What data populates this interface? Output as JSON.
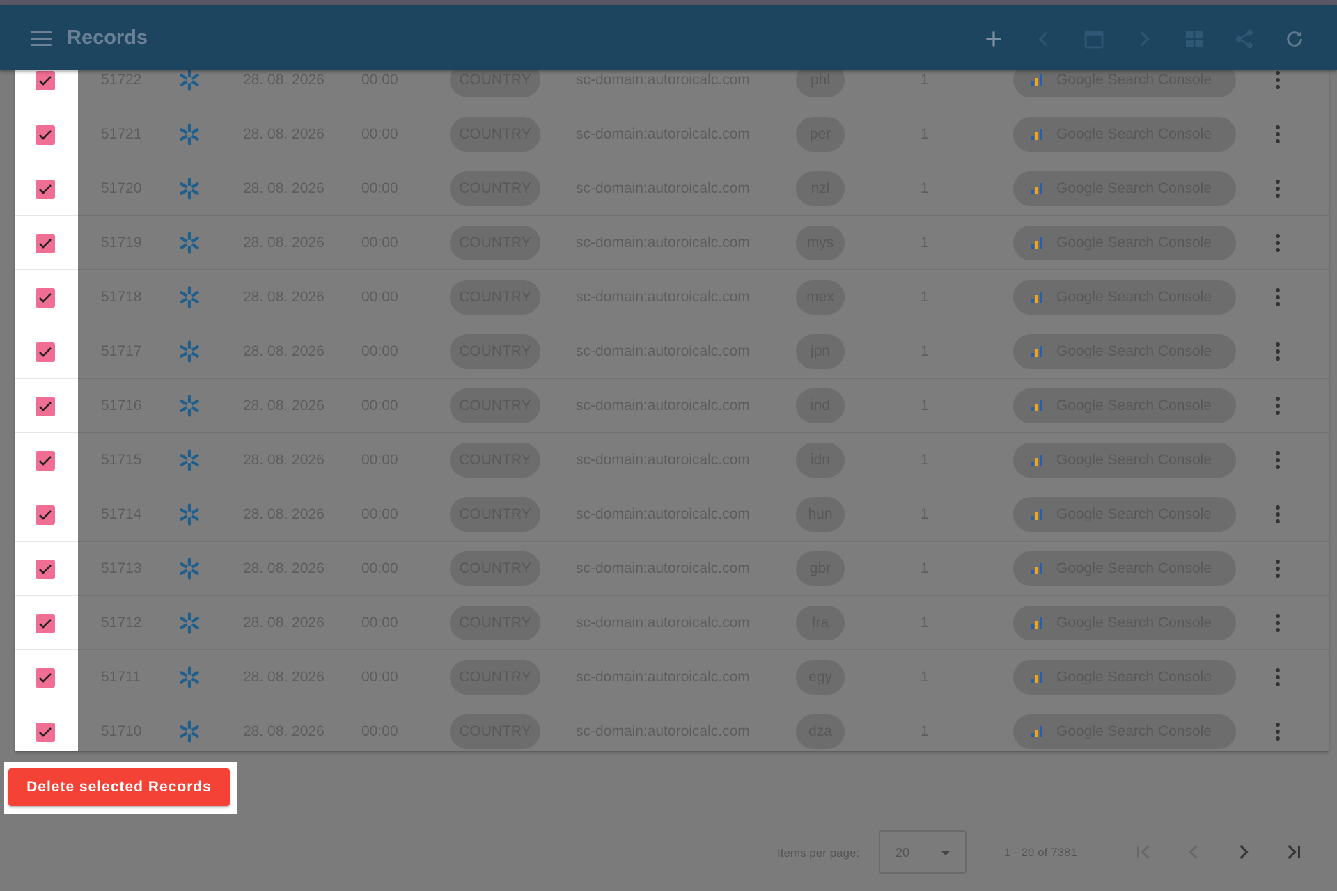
{
  "app": {
    "title": "Records"
  },
  "toolbar": {
    "icons": [
      "menu-icon",
      "add-icon",
      "chevron-left-icon",
      "calendar-icon",
      "chevron-right-icon",
      "grid-icon",
      "share-icon",
      "refresh-icon"
    ]
  },
  "colors": {
    "toolbar": "#1e4560",
    "checkbox": "#f06d93",
    "delete_button": "#f44336",
    "spark": "#1f5f8e"
  },
  "rows": [
    {
      "id": "51722",
      "date": "28. 08. 2026",
      "time": "00:00",
      "type": "COUNTRY",
      "domain": "sc-domain:autoroicalc.com",
      "code": "phl",
      "count": "1",
      "source": "Google Search Console"
    },
    {
      "id": "51721",
      "date": "28. 08. 2026",
      "time": "00:00",
      "type": "COUNTRY",
      "domain": "sc-domain:autoroicalc.com",
      "code": "per",
      "count": "1",
      "source": "Google Search Console"
    },
    {
      "id": "51720",
      "date": "28. 08. 2026",
      "time": "00:00",
      "type": "COUNTRY",
      "domain": "sc-domain:autoroicalc.com",
      "code": "nzl",
      "count": "1",
      "source": "Google Search Console"
    },
    {
      "id": "51719",
      "date": "28. 08. 2026",
      "time": "00:00",
      "type": "COUNTRY",
      "domain": "sc-domain:autoroicalc.com",
      "code": "mys",
      "count": "1",
      "source": "Google Search Console"
    },
    {
      "id": "51718",
      "date": "28. 08. 2026",
      "time": "00:00",
      "type": "COUNTRY",
      "domain": "sc-domain:autoroicalc.com",
      "code": "mex",
      "count": "1",
      "source": "Google Search Console"
    },
    {
      "id": "51717",
      "date": "28. 08. 2026",
      "time": "00:00",
      "type": "COUNTRY",
      "domain": "sc-domain:autoroicalc.com",
      "code": "jpn",
      "count": "1",
      "source": "Google Search Console"
    },
    {
      "id": "51716",
      "date": "28. 08. 2026",
      "time": "00:00",
      "type": "COUNTRY",
      "domain": "sc-domain:autoroicalc.com",
      "code": "ind",
      "count": "1",
      "source": "Google Search Console"
    },
    {
      "id": "51715",
      "date": "28. 08. 2026",
      "time": "00:00",
      "type": "COUNTRY",
      "domain": "sc-domain:autoroicalc.com",
      "code": "idn",
      "count": "1",
      "source": "Google Search Console"
    },
    {
      "id": "51714",
      "date": "28. 08. 2026",
      "time": "00:00",
      "type": "COUNTRY",
      "domain": "sc-domain:autoroicalc.com",
      "code": "hun",
      "count": "1",
      "source": "Google Search Console"
    },
    {
      "id": "51713",
      "date": "28. 08. 2026",
      "time": "00:00",
      "type": "COUNTRY",
      "domain": "sc-domain:autoroicalc.com",
      "code": "gbr",
      "count": "1",
      "source": "Google Search Console"
    },
    {
      "id": "51712",
      "date": "28. 08. 2026",
      "time": "00:00",
      "type": "COUNTRY",
      "domain": "sc-domain:autoroicalc.com",
      "code": "fra",
      "count": "1",
      "source": "Google Search Console"
    },
    {
      "id": "51711",
      "date": "28. 08. 2026",
      "time": "00:00",
      "type": "COUNTRY",
      "domain": "sc-domain:autoroicalc.com",
      "code": "egy",
      "count": "1",
      "source": "Google Search Console"
    },
    {
      "id": "51710",
      "date": "28. 08. 2026",
      "time": "00:00",
      "type": "COUNTRY",
      "domain": "sc-domain:autoroicalc.com",
      "code": "dza",
      "count": "1",
      "source": "Google Search Console"
    }
  ],
  "actions": {
    "delete_label": "Delete selected Records"
  },
  "paginator": {
    "items_per_page_label": "Items per page:",
    "items_per_page": "20",
    "range": "1 - 20 of 7381"
  }
}
